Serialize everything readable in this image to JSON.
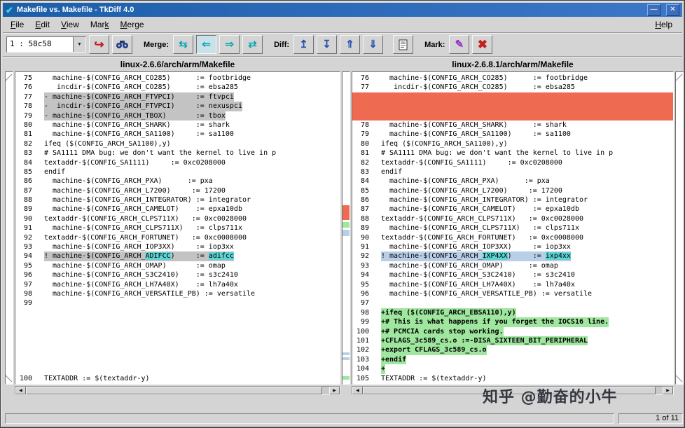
{
  "window": {
    "title": "Makefile vs. Makefile - TkDiff 4.0"
  },
  "menu": {
    "items": [
      {
        "pre": "",
        "key": "F",
        "post": "ile"
      },
      {
        "pre": "",
        "key": "E",
        "post": "dit"
      },
      {
        "pre": "",
        "key": "V",
        "post": "iew"
      },
      {
        "pre": "Mar",
        "key": "k",
        "post": ""
      },
      {
        "pre": "",
        "key": "M",
        "post": "erge"
      }
    ],
    "help": {
      "pre": "",
      "key": "H",
      "post": "elp"
    }
  },
  "toolbar": {
    "combo_value": "1 : 58c58",
    "merge_label": "Merge:",
    "diff_label": "Diff:",
    "mark_label": "Mark:"
  },
  "icons": {
    "app": "✔",
    "minimize": "—",
    "close": "✕",
    "dropdown": "▼",
    "center": "↪",
    "merge_lr": "⇆",
    "merge_left": "⇐",
    "merge_right": "⇒",
    "merge_swap": "⇄",
    "first_diff": "↥",
    "last_diff": "↧",
    "prev_diff": "⇑",
    "next_diff": "⇓",
    "set_mark": "✎",
    "clear_mark": "✖",
    "hscroll_left": "◀",
    "hscroll_right": "▶"
  },
  "colors": {
    "titlebar": "#1c5eaa",
    "delete-bg": "#c3c3c3",
    "pad-bg": "#ee6a50",
    "add-bg": "#9fe69f",
    "change-bg": "#b9cfe8",
    "inline-bg": "#5fd3d3",
    "accent-cyan": "#0da5b5",
    "accent-blue": "#2453b0",
    "accent-red": "#c41f1f",
    "accent-purple": "#9c2fc4"
  },
  "status": {
    "count": "1 of 11"
  },
  "watermark": "知乎 @勤奋的小牛",
  "left_pane": {
    "title": "linux-2.6.6/arch/arm/Makefile",
    "rows": [
      {
        "num": "75",
        "text": "  machine-$(CONFIG_ARCH_CO285)      := footbridge"
      },
      {
        "num": "76",
        "text": "   incdir-$(CONFIG_ARCH_CO285)      := ebsa285"
      },
      {
        "num": "77",
        "bg": "del",
        "text": "- machine-$(CONFIG_ARCH_FTVPCI)     := ftvpci"
      },
      {
        "num": "78",
        "bg": "del",
        "text": "-  incdir-$(CONFIG_ARCH_FTVPCI)     := nexuspci"
      },
      {
        "num": "79",
        "bg": "del",
        "text": "- machine-$(CONFIG_ARCH_TBOX)       := tbox"
      },
      {
        "num": "80",
        "text": "  machine-$(CONFIG_ARCH_SHARK)      := shark"
      },
      {
        "num": "81",
        "text": "  machine-$(CONFIG_ARCH_SA1100)     := sa1100"
      },
      {
        "num": "82",
        "text": "ifeq ($(CONFIG_ARCH_SA1100),y)"
      },
      {
        "num": "83",
        "text": "# SA1111 DMA bug: we don't want the kernel to live in p"
      },
      {
        "num": "84",
        "text": "textaddr-$(CONFIG_SA1111)     := 0xc0208000"
      },
      {
        "num": "85",
        "text": "endif"
      },
      {
        "num": "86",
        "text": "  machine-$(CONFIG_ARCH_PXA)      := pxa"
      },
      {
        "num": "87",
        "text": "  machine-$(CONFIG_ARCH_L7200)     := 17200"
      },
      {
        "num": "88",
        "text": "  machine-$(CONFIG_ARCH_INTEGRATOR) := integrator"
      },
      {
        "num": "89",
        "text": "  machine-$(CONFIG_ARCH_CAMELOT)    := epxa10db"
      },
      {
        "num": "90",
        "text": "textaddr-$(CONFIG_ARCH_CLPS711X)   := 0xc0028000"
      },
      {
        "num": "91",
        "text": "  machine-$(CONFIG_ARCH_CLPS711X)   := clps711x"
      },
      {
        "num": "92",
        "text": "textaddr-$(CONFIG_ARCH_FORTUNET)   := 0xc0008000"
      },
      {
        "num": "93",
        "text": "  machine-$(CONFIG_ARCH_IOP3XX)     := iop3xx"
      },
      {
        "num": "94",
        "bg": "change",
        "seg": [
          {
            "t": "! machine-$(CONFIG_ARCH_"
          },
          {
            "t": "ADIFCC",
            "m": true
          },
          {
            "t": ")     := "
          },
          {
            "t": "adifcc",
            "m": true
          }
        ]
      },
      {
        "num": "95",
        "text": "  machine-$(CONFIG_ARCH_OMAP)       := omap"
      },
      {
        "num": "96",
        "text": "  machine-$(CONFIG_ARCH_S3C2410)    := s3c2410"
      },
      {
        "num": "97",
        "text": "  machine-$(CONFIG_ARCH_LH7A40X)    := lh7a40x"
      },
      {
        "num": "98",
        "text": "  machine-$(CONFIG_ARCH_VERSATILE_PB) := versatile"
      },
      {
        "num": "99",
        "text": ""
      },
      {
        "num": "",
        "text": ""
      },
      {
        "num": "",
        "text": ""
      },
      {
        "num": "",
        "text": ""
      },
      {
        "num": "",
        "text": ""
      },
      {
        "num": "",
        "text": ""
      },
      {
        "num": "",
        "text": ""
      },
      {
        "num": "",
        "text": ""
      },
      {
        "num": "100",
        "text": "TEXTADDR := $(textaddr-y)"
      }
    ]
  },
  "right_pane": {
    "title": "linux-2.6.8.1/arch/arm/Makefile",
    "rows": [
      {
        "num": "76",
        "text": "  machine-$(CONFIG_ARCH_CO285)      := footbridge"
      },
      {
        "num": "77",
        "text": "   incdir-$(CONFIG_ARCH_CO285)      := ebsa285"
      },
      {
        "num": "",
        "bg": "pad",
        "text": ""
      },
      {
        "num": "",
        "bg": "pad",
        "text": ""
      },
      {
        "num": "",
        "bg": "pad",
        "text": ""
      },
      {
        "num": "78",
        "text": "  machine-$(CONFIG_ARCH_SHARK)      := shark"
      },
      {
        "num": "79",
        "text": "  machine-$(CONFIG_ARCH_SA1100)     := sa1100"
      },
      {
        "num": "80",
        "text": "ifeq ($(CONFIG_ARCH_SA1100),y)"
      },
      {
        "num": "81",
        "text": "# SA1111 DMA bug: we don't want the kernel to live in p"
      },
      {
        "num": "82",
        "text": "textaddr-$(CONFIG_SA1111)     := 0xc0208000"
      },
      {
        "num": "83",
        "text": "endif"
      },
      {
        "num": "84",
        "text": "  machine-$(CONFIG_ARCH_PXA)      := pxa"
      },
      {
        "num": "85",
        "text": "  machine-$(CONFIG_ARCH_L7200)     := 17200"
      },
      {
        "num": "86",
        "text": "  machine-$(CONFIG_ARCH_INTEGRATOR) := integrator"
      },
      {
        "num": "87",
        "text": "  machine-$(CONFIG_ARCH_CAMELOT)    := epxa10db"
      },
      {
        "num": "88",
        "text": "textaddr-$(CONFIG_ARCH_CLPS711X)   := 0xc0028000"
      },
      {
        "num": "89",
        "text": "  machine-$(CONFIG_ARCH_CLPS711X)   := clps711x"
      },
      {
        "num": "90",
        "text": "textaddr-$(CONFIG_ARCH_FORTUNET)   := 0xc0008000"
      },
      {
        "num": "91",
        "text": "  machine-$(CONFIG_ARCH_IOP3XX)     := iop3xx"
      },
      {
        "num": "92",
        "bg": "changeR",
        "seg": [
          {
            "t": "! machine-$(CONFIG_ARCH_"
          },
          {
            "t": "IXP4XX",
            "m": true
          },
          {
            "t": ")     := "
          },
          {
            "t": "ixp4xx",
            "m": true
          }
        ]
      },
      {
        "num": "93",
        "text": "  machine-$(CONFIG_ARCH_OMAP)      := omap"
      },
      {
        "num": "94",
        "text": "  machine-$(CONFIG_ARCH_S3C2410)    := s3c2410"
      },
      {
        "num": "95",
        "text": "  machine-$(CONFIG_ARCH_LH7A40X)    := lh7a40x"
      },
      {
        "num": "96",
        "text": "  machine-$(CONFIG_ARCH_VERSATILE_PB) := versatile"
      },
      {
        "num": "97",
        "text": ""
      },
      {
        "num": "98",
        "bg": "add",
        "text": "+ifeq ($(CONFIG_ARCH_EBSA110),y)"
      },
      {
        "num": "99",
        "bg": "add",
        "text": "+# This is what happens if you forget the IOCS16 line."
      },
      {
        "num": "100",
        "bg": "add",
        "text": "+# PCMCIA cards stop working."
      },
      {
        "num": "101",
        "bg": "add",
        "text": "+CFLAGS_3c589_cs.o :=-DISA_SIXTEEN_BIT_PERIPHERAL"
      },
      {
        "num": "102",
        "bg": "add",
        "text": "+export CFLAGS_3c589_cs.o"
      },
      {
        "num": "103",
        "bg": "add",
        "text": "+endif"
      },
      {
        "num": "104",
        "bg": "add",
        "text": "+"
      },
      {
        "num": "105",
        "text": "TEXTADDR := $(textaddr-y)"
      }
    ]
  }
}
